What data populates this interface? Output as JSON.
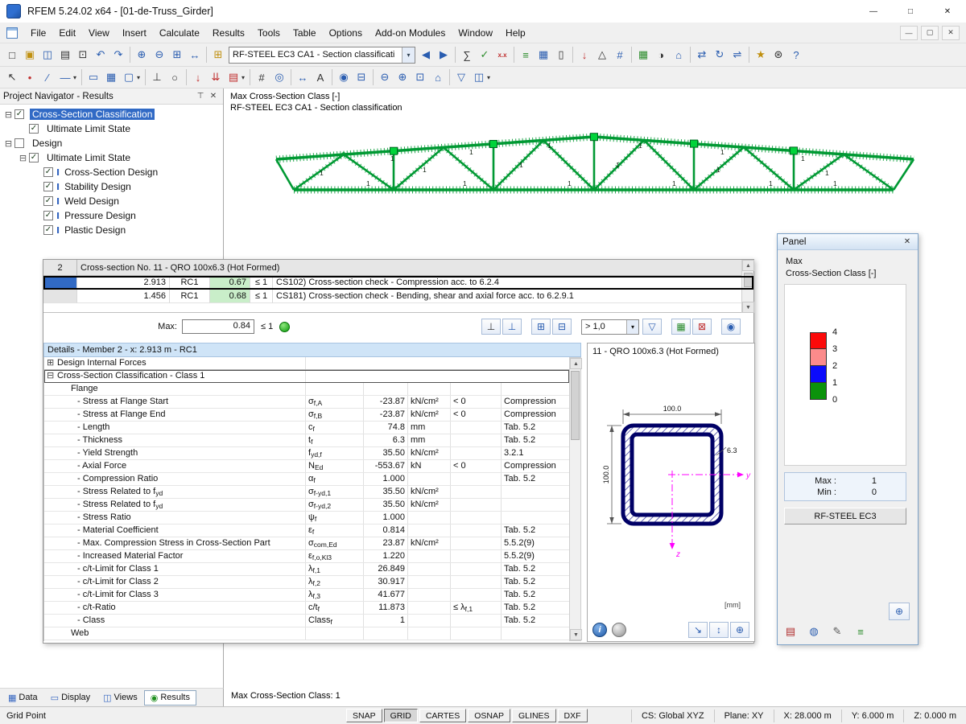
{
  "colors": {
    "truss": "#009933",
    "selection": "#316ac5"
  },
  "titlebar": {
    "title": "RFEM 5.24.02 x64 - [01-de-Truss_Girder]",
    "buttons": [
      {
        "n": "minimize-button",
        "g": "—"
      },
      {
        "n": "maximize-button",
        "g": "□"
      },
      {
        "n": "close-button",
        "g": "✕"
      }
    ]
  },
  "menubar": {
    "items": [
      "File",
      "Edit",
      "View",
      "Insert",
      "Calculate",
      "Results",
      "Tools",
      "Table",
      "Options",
      "Add-on Modules",
      "Window",
      "Help"
    ],
    "mdi_buttons": [
      {
        "n": "mdi-minimize-button",
        "g": "—"
      },
      {
        "n": "mdi-restore-button",
        "g": "▢"
      },
      {
        "n": "mdi-close-button",
        "g": "✕"
      }
    ]
  },
  "toolbar1": {
    "combo": "RF-STEEL EC3 CA1 - Section classificati",
    "combo_caret": "▾",
    "left": [
      {
        "n": "new-file-icon",
        "g": "□",
        "c": "dk"
      },
      {
        "n": "open-file-icon",
        "g": "▣",
        "c": "yl"
      },
      {
        "n": "save-icon",
        "g": "◫",
        "c": "bl"
      },
      {
        "n": "print-icon",
        "g": "▤",
        "c": "dk"
      },
      {
        "n": "copy-icon",
        "g": "⊡",
        "c": "dk"
      },
      {
        "n": "undo-icon",
        "g": "↶",
        "c": "bl"
      },
      {
        "n": "redo-icon",
        "g": "↷",
        "c": "bl"
      },
      {
        "c": "sep"
      },
      {
        "n": "zoom-in-icon",
        "g": "⊕",
        "c": "bl"
      },
      {
        "n": "zoom-out-icon",
        "g": "⊖",
        "c": "bl"
      },
      {
        "n": "zoom-window-icon",
        "g": "⊞",
        "c": "bl"
      },
      {
        "n": "pan-view-icon",
        "g": "↔",
        "c": "bl"
      },
      {
        "c": "sep"
      },
      {
        "n": "tables-icon",
        "g": "⊞",
        "c": "yl"
      }
    ],
    "right": [
      {
        "n": "previous-case-icon",
        "g": "◀",
        "c": "bl"
      },
      {
        "n": "next-case-icon",
        "g": "▶",
        "c": "bl"
      },
      {
        "c": "sep"
      },
      {
        "n": "calculator-icon",
        "g": "∑",
        "c": "dk"
      },
      {
        "n": "check-calculation-icon",
        "g": "✓",
        "c": "gn"
      },
      {
        "n": "calculation-params-icon",
        "g": "x.x",
        "c": "rd sm"
      },
      {
        "c": "sep"
      },
      {
        "n": "results-toggle-icon",
        "g": "≡",
        "c": "gn"
      },
      {
        "n": "result-values-icon",
        "g": "▦",
        "c": "bl"
      },
      {
        "n": "panel-toggle-icon",
        "g": "▯",
        "c": "dk"
      },
      {
        "c": "sep"
      },
      {
        "n": "loads-icon",
        "g": "↓",
        "c": "rd"
      },
      {
        "n": "supports-icon",
        "g": "△",
        "c": "dk"
      },
      {
        "n": "numbering-icon",
        "g": "#",
        "c": "bl"
      },
      {
        "c": "sep"
      },
      {
        "n": "render-mode-icon",
        "g": "▦",
        "c": "gn"
      },
      {
        "n": "shadow-mode-icon",
        "g": "◑",
        "c": "dk"
      },
      {
        "n": "isometric-view-icon",
        "g": "⌂",
        "c": "bl"
      },
      {
        "c": "sep"
      },
      {
        "n": "move-copy-icon",
        "g": "⇄",
        "c": "bl"
      },
      {
        "n": "rotate-icon",
        "g": "↻",
        "c": "bl"
      },
      {
        "n": "mirror-icon",
        "g": "⇌",
        "c": "bl"
      },
      {
        "c": "sep"
      },
      {
        "n": "module-favorites-icon",
        "g": "★",
        "c": "yl"
      },
      {
        "n": "settings-icon",
        "g": "⊛",
        "c": "dk"
      },
      {
        "n": "help-icon",
        "g": "?",
        "c": "bl"
      }
    ]
  },
  "toolbar2": {
    "icons": [
      {
        "n": "select-arrow-icon",
        "g": "↖",
        "c": "dk"
      },
      {
        "n": "node-tool-icon",
        "g": "•",
        "c": "rd"
      },
      {
        "n": "line-tool-icon",
        "g": "∕",
        "c": "bl"
      },
      {
        "n": "member-tool-icon",
        "g": "—",
        "c": "bl"
      },
      {
        "n": "dropdown-caret-icon",
        "g": "▾",
        "c": "dk xs"
      },
      {
        "c": "sep"
      },
      {
        "n": "surface-tool-icon",
        "g": "▭",
        "c": "bl"
      },
      {
        "n": "solid-tool-icon",
        "g": "▦",
        "c": "bl"
      },
      {
        "n": "opening-tool-icon",
        "g": "▢",
        "c": "bl"
      },
      {
        "n": "dropdown-caret-icon",
        "g": "▾",
        "c": "dk xs"
      },
      {
        "c": "sep"
      },
      {
        "n": "support-tool-icon",
        "g": "⊥",
        "c": "dk"
      },
      {
        "n": "hinge-tool-icon",
        "g": "○",
        "c": "dk"
      },
      {
        "c": "sep"
      },
      {
        "n": "nodal-load-icon",
        "g": "↓",
        "c": "rd"
      },
      {
        "n": "line-load-icon",
        "g": "⇊",
        "c": "rd"
      },
      {
        "n": "area-load-icon",
        "g": "▤",
        "c": "rd"
      },
      {
        "n": "dropdown-caret-icon",
        "g": "▾",
        "c": "dk xs"
      },
      {
        "c": "sep"
      },
      {
        "n": "grid-icon",
        "g": "#",
        "c": "dk"
      },
      {
        "n": "object-snap-icon",
        "g": "◎",
        "c": "bl"
      },
      {
        "c": "sep"
      },
      {
        "n": "dimension-icon",
        "g": "↔",
        "c": "bl"
      },
      {
        "n": "text-comment-icon",
        "g": "A",
        "c": "dk"
      },
      {
        "c": "sep"
      },
      {
        "n": "visibility-icon",
        "g": "◉",
        "c": "bl"
      },
      {
        "n": "section-clip-icon",
        "g": "⊟",
        "c": "bl"
      },
      {
        "c": "sep"
      },
      {
        "n": "view-zoom-out-icon",
        "g": "⊖",
        "c": "bl"
      },
      {
        "n": "view-zoom-in-icon",
        "g": "⊕",
        "c": "bl"
      },
      {
        "n": "full-view-icon",
        "g": "⊡",
        "c": "bl"
      },
      {
        "n": "isometry-icon",
        "g": "⌂",
        "c": "bl"
      },
      {
        "c": "sep"
      },
      {
        "n": "filter-icon",
        "g": "▽",
        "c": "bl"
      },
      {
        "n": "partial-view-icon",
        "g": "◫",
        "c": "bl"
      },
      {
        "n": "dropdown-caret-icon",
        "g": "▾",
        "c": "dk xs"
      }
    ]
  },
  "navigator": {
    "title": "Project Navigator - Results",
    "pin_icon": "⊤",
    "close_icon": "✕",
    "tree": [
      {
        "n": "nav-cross-section-classification",
        "cls": "lvl0",
        "exp": "⊟",
        "check": "✓",
        "lblcls": "sel",
        "label": "Cross-Section Classification"
      },
      {
        "n": "nav-ultimate-limit-state-1",
        "cls": "lvl1",
        "exp": "",
        "check": "✓",
        "label": "Ultimate Limit State"
      },
      {
        "n": "nav-design",
        "cls": "lvl0",
        "exp": "⊟",
        "check": "",
        "label": "Design"
      },
      {
        "n": "nav-ultimate-limit-state-2",
        "cls": "lvl1",
        "exp": "⊟",
        "check": "✓",
        "label": "Ultimate Limit State"
      },
      {
        "n": "nav-cross-section-design",
        "cls": "lvl2",
        "exp": "",
        "check": "✓",
        "icon": "Ⅰ",
        "label": "Cross-Section Design"
      },
      {
        "n": "nav-stability-design",
        "cls": "lvl2",
        "exp": "",
        "check": "✓",
        "icon": "Ⅰ",
        "label": "Stability Design"
      },
      {
        "n": "nav-weld-design",
        "cls": "lvl2",
        "exp": "",
        "check": "✓",
        "icon": "Ⅰ",
        "label": "Weld Design"
      },
      {
        "n": "nav-pressure-design",
        "cls": "lvl2",
        "exp": "",
        "check": "✓",
        "icon": "Ⅰ",
        "label": "Pressure Design"
      },
      {
        "n": "nav-plastic-design",
        "cls": "lvl2",
        "exp": "",
        "check": "✓",
        "icon": "Ⅰ",
        "label": "Plastic Design"
      }
    ]
  },
  "viewport": {
    "caption1": "Max Cross-Section Class [-]",
    "caption2": "RF-STEEL EC3 CA1 - Section classification",
    "status_text": "Max Cross-Section Class: 1",
    "member_label": "1"
  },
  "results_window": {
    "table": {
      "row_no": "2",
      "section_header": "Cross-section No. 11 - QRO 100x6.3 (Hot Formed)",
      "rows": [
        {
          "rowcls": "sel",
          "x": "2.913",
          "rc": "RC1",
          "ratio": "0.67",
          "limit": "≤ 1",
          "desc": "CS102) Cross-section check - Compression acc. to 6.2.4"
        },
        {
          "rowcls": "",
          "x": "1.456",
          "rc": "RC1",
          "ratio": "0.68",
          "limit": "≤ 1",
          "desc": "CS181) Cross-section check - Bending, shear and axial force acc. to 6.2.9.1"
        }
      ]
    },
    "max": {
      "label": "Max:",
      "value": "0.84",
      "limit": "≤ 1"
    },
    "filter_combo": {
      "value": "> 1,0",
      "caret": "▾"
    },
    "max_buttons_a": [
      {
        "n": "result-diagram-icon",
        "g": "⊥",
        "c": "dk"
      },
      {
        "n": "result-diagram-colored-icon",
        "g": "⊥",
        "c": "bl"
      },
      {
        "c": "gap"
      },
      {
        "n": "export-table-icon",
        "g": "⊞",
        "c": "bl"
      },
      {
        "n": "import-table-icon",
        "g": "⊟",
        "c": "bl"
      },
      {
        "c": "gap"
      }
    ],
    "max_buttons_b": [
      {
        "n": "filter-funnel-icon",
        "g": "▽",
        "c": "bl"
      },
      {
        "c": "gap"
      },
      {
        "n": "color-scale-icon",
        "g": "▦",
        "c": "gn"
      },
      {
        "n": "delete-results-icon",
        "g": "⊠",
        "c": "rd"
      },
      {
        "c": "gap"
      },
      {
        "n": "visibility-eye-icon",
        "g": "◉",
        "c": "bl"
      }
    ],
    "details": {
      "header": "Details - Member 2 - x: 2.913 m - RC1",
      "rows": [
        {
          "cls": "node",
          "exp": "⊞",
          "label": "Design Internal Forces"
        },
        {
          "cls": "node focus",
          "exp": "⊟",
          "label": "Cross-Section Classification - Class 1"
        },
        {
          "cls": "group",
          "label": "Flange"
        },
        {
          "cls": "item",
          "label": "- Stress at Flange Start",
          "sym": "σ",
          "sub": "f,A",
          "value": "-23.87",
          "unit": "kN/cm²",
          "cond": "< 0",
          "ref": "Compression"
        },
        {
          "cls": "item",
          "label": "- Stress at Flange End",
          "sym": "σ",
          "sub": "f,B",
          "value": "-23.87",
          "unit": "kN/cm²",
          "cond": "< 0",
          "ref": "Compression"
        },
        {
          "cls": "item",
          "label": "- Length",
          "sym": "c",
          "sub": "f",
          "value": "74.8",
          "unit": "mm",
          "ref": "Tab. 5.2"
        },
        {
          "cls": "item",
          "label": "- Thickness",
          "sym": "t",
          "sub": "f",
          "value": "6.3",
          "unit": "mm",
          "ref": "Tab. 5.2"
        },
        {
          "cls": "item",
          "label": "- Yield Strength",
          "sym": "f",
          "sub": "yd,f",
          "value": "35.50",
          "unit": "kN/cm²",
          "ref": "3.2.1"
        },
        {
          "cls": "item",
          "label": "- Axial Force",
          "sym": "N",
          "sub": "Ed",
          "value": "-553.67",
          "unit": "kN",
          "cond": "< 0",
          "ref": "Compression"
        },
        {
          "cls": "item",
          "label": "- Compression Ratio",
          "sym": "α",
          "sub": "f",
          "value": "1.000",
          "ref": "Tab. 5.2"
        },
        {
          "cls": "item",
          "label": "- Stress Related to f",
          "lsub": "yd",
          "sym": "σ",
          "sub": "f-yd,1",
          "value": "35.50",
          "unit": "kN/cm²"
        },
        {
          "cls": "item",
          "label": "- Stress Related to f",
          "lsub": "yd",
          "sym": "σ",
          "sub": "f-yd,2",
          "value": "35.50",
          "unit": "kN/cm²"
        },
        {
          "cls": "item",
          "label": "- Stress Ratio",
          "sym": "ψ",
          "sub": "f",
          "value": "1.000"
        },
        {
          "cls": "item",
          "label": "- Material Coefficient",
          "sym": "ε",
          "sub": "f",
          "value": "0.814",
          "ref": "Tab. 5.2"
        },
        {
          "cls": "item",
          "label": "- Max. Compression Stress in Cross-Section Part",
          "sym": "σ",
          "sub": "com,Ed",
          "value": "23.87",
          "unit": "kN/cm²",
          "ref": "5.5.2(9)"
        },
        {
          "cls": "item",
          "label": "- Increased Material Factor",
          "sym": "ε",
          "sub": "f,o,Kl3",
          "value": "1.220",
          "ref": "5.5.2(9)"
        },
        {
          "cls": "item",
          "label": "- c/t-Limit for Class 1",
          "sym": "λ",
          "sub": "f,1",
          "value": "26.849",
          "ref": "Tab. 5.2"
        },
        {
          "cls": "item",
          "label": "- c/t-Limit for Class 2",
          "sym": "λ",
          "sub": "f,2",
          "value": "30.917",
          "ref": "Tab. 5.2"
        },
        {
          "cls": "item",
          "label": "- c/t-Limit for Class 3",
          "sym": "λ",
          "sub": "f,3",
          "value": "41.677",
          "ref": "Tab. 5.2"
        },
        {
          "cls": "item",
          "label": "- c/t-Ratio",
          "sym": "c/t",
          "sub": "f",
          "value": "11.873",
          "cond": "≤ λ",
          "cond_sub": "f,1",
          "ref": "Tab. 5.2"
        },
        {
          "cls": "item",
          "label": "- Class",
          "sym": "Class",
          "sub": "f",
          "value": "1",
          "ref": "Tab. 5.2"
        },
        {
          "cls": "group",
          "label": "Web"
        }
      ]
    },
    "section_view": {
      "title": "11 - QRO 100x6.3 (Hot Formed)",
      "dim_width": "100.0",
      "dim_height": "100.0",
      "dim_thickness": "6.3",
      "axis_y": "y",
      "axis_z": "z",
      "units": "[mm]",
      "info_glyph": "i",
      "buttons": [
        {
          "n": "section-pointer-icon",
          "g": "↘"
        },
        {
          "n": "section-dimensions-icon",
          "g": "↕"
        },
        {
          "n": "section-zoom-icon",
          "g": "⊕"
        }
      ]
    }
  },
  "panel": {
    "title": "Panel",
    "close_icon": "✕",
    "line1": "Max",
    "line2": "Cross-Section Class [-]",
    "legend": {
      "colors": [
        "#fc0a0a",
        "#fb8b8b",
        "#0b0bfc",
        "#0b930b"
      ],
      "ticks": [
        "4",
        "3",
        "2",
        "1",
        "0"
      ]
    },
    "maxmin": [
      {
        "label": "Max :",
        "value": "1"
      },
      {
        "label": "Min :",
        "value": "0"
      }
    ],
    "module_button": "RF-STEEL EC3",
    "zoom_button_glyph": "⊕",
    "icons": [
      {
        "n": "panel-colors-icon",
        "g": "▤",
        "c": "rd"
      },
      {
        "n": "panel-factors-icon",
        "g": "◍",
        "c": "bl"
      },
      {
        "n": "panel-isolines-icon",
        "g": "✎",
        "c": "dk"
      },
      {
        "n": "panel-scale-icon",
        "g": "≡",
        "c": "gn"
      }
    ]
  },
  "tabs": [
    {
      "n": "tab-data",
      "icon": "▦",
      "c": "ti-blue",
      "label": "Data",
      "cls": ""
    },
    {
      "n": "tab-display",
      "icon": "▭",
      "c": "ti-blue",
      "label": "Display",
      "cls": ""
    },
    {
      "n": "tab-views",
      "icon": "◫",
      "c": "ti-blue",
      "label": "Views",
      "cls": ""
    },
    {
      "n": "tab-results",
      "icon": "◉",
      "c": "ti-green",
      "label": "Results",
      "cls": "on"
    }
  ],
  "statusbar": {
    "left": "Grid Point",
    "buttons": [
      {
        "label": "SNAP",
        "cls": ""
      },
      {
        "label": "GRID",
        "cls": "on"
      },
      {
        "label": "CARTES",
        "cls": ""
      },
      {
        "label": "OSNAP",
        "cls": ""
      },
      {
        "label": "GLINES",
        "cls": ""
      },
      {
        "label": "DXF",
        "cls": ""
      }
    ],
    "fields": [
      "CS: Global XYZ",
      "Plane: XY",
      "X: 28.000 m",
      "Y: 6.000 m",
      "Z: 0.000 m"
    ]
  }
}
